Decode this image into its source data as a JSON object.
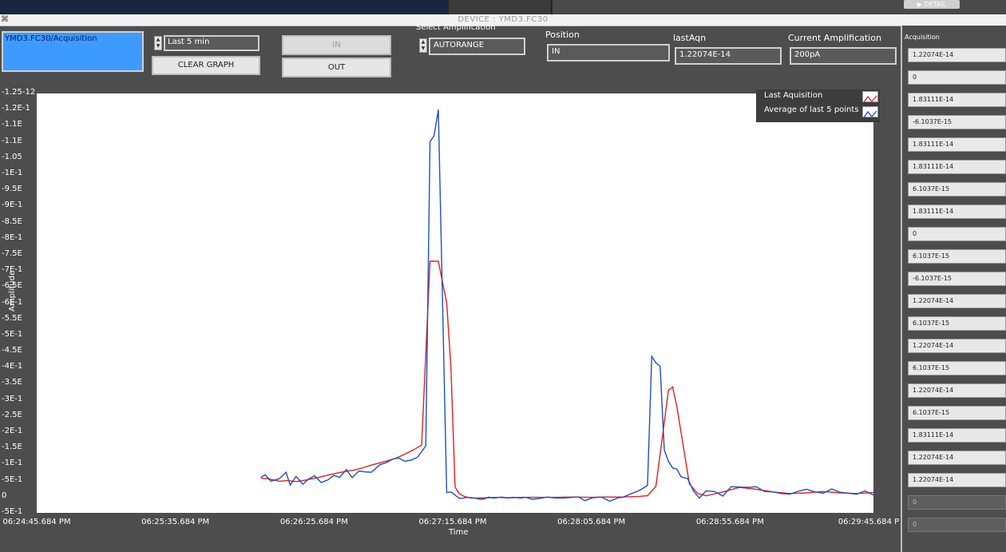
{
  "window": {
    "title": "DEVICE : YMD3.FC30",
    "detail_button": "DETAIL"
  },
  "controls": {
    "device_path": "YMD3.FC30/Acquisition",
    "time_range": "Last 5 min",
    "clear_graph": "CLEAR GRAPH",
    "in_button": "IN",
    "out_button": "OUT",
    "amplification_label": "Select Amplification",
    "amplification_value": "AUTORANGE",
    "position_label": "Position",
    "position_value": "IN",
    "lastaqn_label": "lastAqn",
    "lastaqn_value": "1.22074E-14",
    "current_amp_label": "Current Amplification",
    "current_amp_value": "200pA"
  },
  "legend": {
    "series1": "Last Aquisition",
    "series2": "Average of last 5 points"
  },
  "acquisition_list": {
    "title": "Acquisition",
    "items": [
      "1.22074E-14",
      "0",
      "1.83111E-14",
      "-6.1037E-15",
      "1.83111E-14",
      "1.83111E-14",
      "6.1037E-15",
      "1.83111E-14",
      "0",
      "6.1037E-15",
      "-6.1037E-15",
      "1.22074E-14",
      "6.1037E-15",
      "1.22074E-14",
      "6.1037E-15",
      "1.22074E-14",
      "6.1037E-15",
      "1.83111E-14",
      "1.22074E-14",
      "1.22074E-14",
      "0",
      "0"
    ]
  },
  "chart_data": {
    "type": "line",
    "xlabel": "Time",
    "ylabel": "Amplitude",
    "x_tick_labels": [
      "06:24:45.684 PM",
      "06:25:35.684 PM",
      "06:26:25.684 PM",
      "06:27:15.684 PM",
      "06:28:05.684 PM",
      "06:28:55.684 PM",
      "06:29:45.684 P"
    ],
    "y_tick_labels": [
      "-1.25-12",
      "-1.2E-1",
      "-1.1E",
      "-1.1E",
      "-1.05",
      "-1E-1",
      "-9.5E",
      "-9E-1",
      "-8.5E",
      "-8E-1",
      "-7.5E",
      "-7E-1",
      "-6.5E",
      "-6E-1",
      "-5.5E",
      "-5E-1",
      "-4.5E",
      "-4E-1",
      "-3.5E",
      "-3E-1",
      "-2.5E",
      "-2E-1",
      "-1.5E",
      "-1E-1",
      "-5E-1",
      "0",
      "-5E-1"
    ],
    "legend_position": "top-right",
    "grid": false,
    "series": [
      {
        "name": "Last Aquisition",
        "color": "#1f4fbf",
        "x": [
          0.268,
          0.273,
          0.28,
          0.29,
          0.298,
          0.303,
          0.31,
          0.318,
          0.325,
          0.332,
          0.34,
          0.348,
          0.355,
          0.362,
          0.37,
          0.377,
          0.385,
          0.392,
          0.4,
          0.41,
          0.418,
          0.425,
          0.432,
          0.44,
          0.448,
          0.455,
          0.46,
          0.465,
          0.47,
          0.475,
          0.48,
          0.49,
          0.495,
          0.5,
          0.505,
          0.51,
          0.515,
          0.52,
          0.525,
          0.53,
          0.535,
          0.54,
          0.545,
          0.55,
          0.556,
          0.562,
          0.57,
          0.578,
          0.585,
          0.592,
          0.6,
          0.61,
          0.62,
          0.63,
          0.64,
          0.648,
          0.655,
          0.665,
          0.675,
          0.685,
          0.695,
          0.7,
          0.71,
          0.72,
          0.73,
          0.735,
          0.74,
          0.745,
          0.75,
          0.755,
          0.76,
          0.765,
          0.77,
          0.778,
          0.785,
          0.792,
          0.8,
          0.81,
          0.82,
          0.83,
          0.84,
          0.85,
          0.86,
          0.87,
          0.88,
          0.89,
          0.9,
          0.91,
          0.92,
          0.93,
          0.94,
          0.95,
          0.96,
          0.97,
          0.98,
          0.99,
          1.0
        ],
        "y": [
          -6e-14,
          -6.8e-14,
          -4.8e-14,
          -5.6e-14,
          -7.6e-14,
          -3.6e-14,
          -6.3e-14,
          -3.9e-14,
          -5.5e-14,
          -6.5e-14,
          -4.4e-14,
          -5.2e-14,
          -6.6e-14,
          -6e-14,
          -8.4e-14,
          -5.9e-14,
          -8e-14,
          -7.7e-14,
          -7.6e-14,
          -9.9e-14,
          -1.06e-13,
          -1.16e-13,
          -1.2e-13,
          -1.1e-13,
          -1.14e-13,
          -1.22e-13,
          -1.4e-13,
          -1.58e-13,
          -1.1e-12,
          -1.12e-12,
          -1.2e-12,
          -1.3e-14,
          -1.5e-14,
          -5e-15,
          5e-15,
          4e-15,
          2e-15,
          3e-15,
          5e-15,
          8e-15,
          7e-15,
          1e-15,
          4e-15,
          3e-15,
          1e-15,
          4e-15,
          2e-15,
          4e-15,
          2e-15,
          8e-15,
          6e-15,
          1e-15,
          4e-15,
          4e-15,
          2e-15,
          1e-15,
          1.2e-14,
          3e-15,
          1e-15,
          1.4e-14,
          3e-15,
          2e-15,
          -9e-15,
          -1.9e-14,
          -3.5e-14,
          -4.35e-13,
          -4.15e-13,
          -4.05e-13,
          -1.45e-13,
          -1.1e-13,
          -8.9e-14,
          -8.6e-14,
          -6.2e-14,
          -5.6e-14,
          -1.7e-14,
          4e-15,
          -1.8e-14,
          -1.6e-14,
          -2e-15,
          -3.1e-14,
          -3e-14,
          -2.9e-14,
          -3.1e-14,
          -1.6e-14,
          -1.5e-14,
          -1e-14,
          -8e-15,
          -1.7e-14,
          -2.3e-14,
          -1.5e-14,
          -1.1e-14,
          -2.4e-14,
          -1.4e-14,
          -1.1e-14,
          -8e-15,
          -1.8e-14,
          -5e-15
        ]
      },
      {
        "name": "Average of last 5 points",
        "color": "#e02020",
        "x": [
          0.268,
          0.278,
          0.29,
          0.3,
          0.31,
          0.32,
          0.33,
          0.34,
          0.35,
          0.36,
          0.37,
          0.38,
          0.39,
          0.4,
          0.41,
          0.42,
          0.43,
          0.44,
          0.45,
          0.46,
          0.47,
          0.48,
          0.49,
          0.495,
          0.5,
          0.505,
          0.51,
          0.515,
          0.52,
          0.53,
          0.54,
          0.55,
          0.56,
          0.57,
          0.58,
          0.6,
          0.62,
          0.64,
          0.66,
          0.68,
          0.7,
          0.72,
          0.73,
          0.74,
          0.75,
          0.755,
          0.76,
          0.765,
          0.77,
          0.78,
          0.79,
          0.8,
          0.82,
          0.84,
          0.86,
          0.88,
          0.9,
          0.92,
          0.94,
          0.96,
          0.98,
          1.0
        ],
        "y": [
          -5.8e-14,
          -5.5e-14,
          -4.8e-14,
          -5e-14,
          -4.7e-14,
          -5.1e-14,
          -5.6e-14,
          -6.2e-14,
          -6.8e-14,
          -7.4e-14,
          -7.9e-14,
          -8.3e-14,
          -9e-14,
          -9.8e-14,
          -1.05e-13,
          -1.12e-13,
          -1.2e-13,
          -1.32e-13,
          -1.45e-13,
          -1.6e-13,
          -7.3e-13,
          -7.3e-13,
          -6e-13,
          -4e-13,
          -3e-14,
          -1e-14,
          -2e-15,
          2e-15,
          4e-15,
          4e-15,
          3e-15,
          2e-15,
          3e-15,
          3e-15,
          2e-15,
          2e-15,
          2e-15,
          1e-15,
          2e-15,
          1e-15,
          1e-15,
          -1e-15,
          -3e-15,
          -3.2e-14,
          -2.3e-13,
          -3.3e-13,
          -3.4e-13,
          -2.8e-13,
          -2e-13,
          -4e-14,
          -1e-14,
          -3e-15,
          -1.5e-14,
          -2.9e-14,
          -2.3e-14,
          -1.5e-14,
          -1e-14,
          -1.2e-14,
          -1.6e-14,
          -1.2e-14,
          -1e-14,
          -1.3e-14
        ]
      }
    ],
    "ylim": [
      -1.25e-12,
      5e-14
    ],
    "xlim": [
      0.0,
      1.0
    ]
  }
}
